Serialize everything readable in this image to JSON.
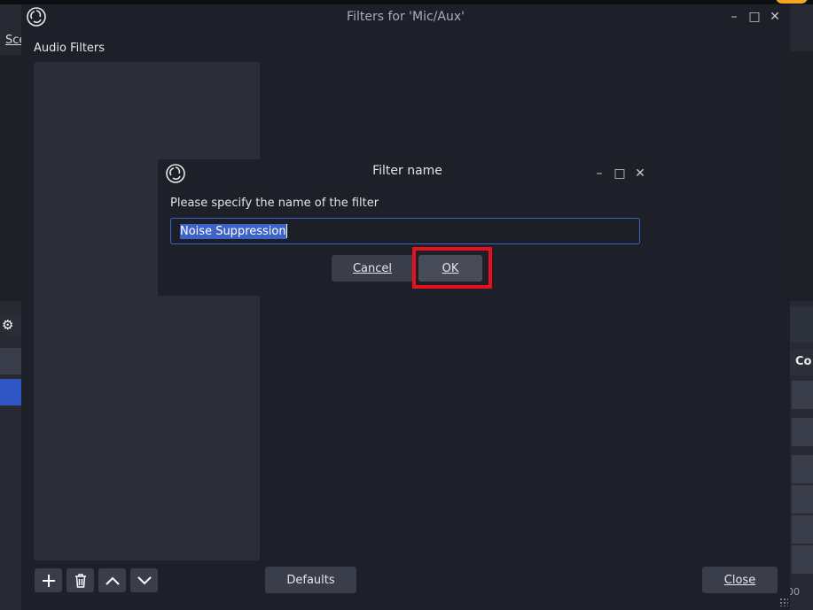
{
  "background": {
    "scene_label": "Sce",
    "right_header": "Co",
    "bottom_right_text": "00"
  },
  "filters_window": {
    "title": "Filters for 'Mic/Aux'",
    "minimize": "–",
    "maximize": "□",
    "close": "✕",
    "section_label": "Audio Filters",
    "defaults_label": "Defaults",
    "close_label": "Close"
  },
  "dialog": {
    "title": "Filter name",
    "minimize": "–",
    "maximize": "□",
    "close": "✕",
    "prompt": "Please specify the name of the filter",
    "input_value": "Noise Suppression",
    "cancel_label": "Cancel",
    "ok_label": "OK"
  },
  "colors": {
    "accent": "#3d63c9",
    "highlight": "#e8101a"
  }
}
